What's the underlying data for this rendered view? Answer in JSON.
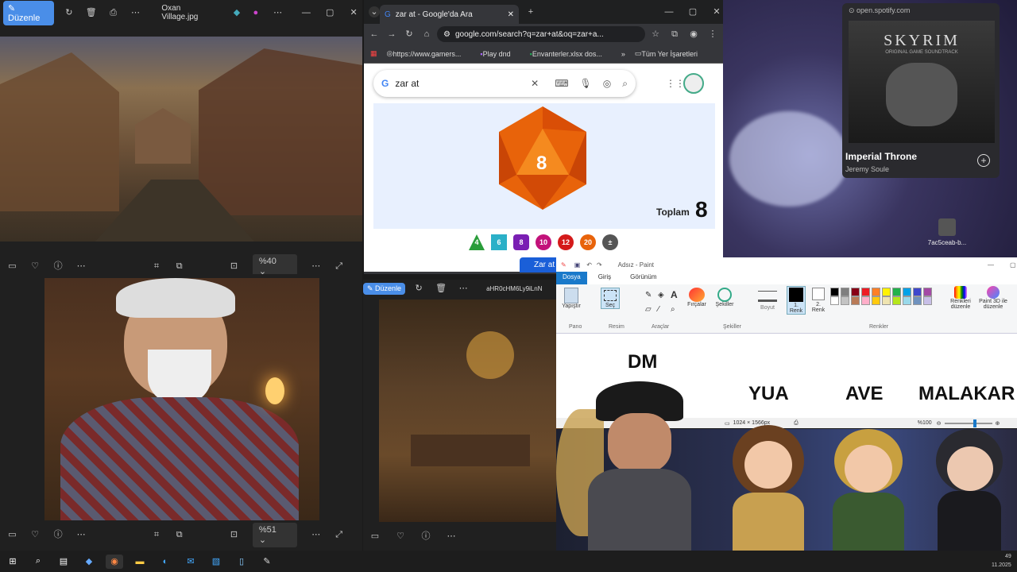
{
  "photos_top": {
    "edit_label": "Düzenle",
    "file_name": "Oxan Village.jpg",
    "zoom": "%40"
  },
  "photos_bottom": {
    "zoom": "%51"
  },
  "photos_mid": {
    "edit_label": "Düzenle",
    "file_name": "aHR0cHM6Ly9iLnN"
  },
  "chrome": {
    "tab_title": "zar at - Google'da Ara",
    "url": "google.com/search?q=zar+at&oq=zar+a...",
    "bookmarks": [
      "https://www.gamers...",
      "Play dnd",
      "Envanterler.xlsx dos...",
      "Tüm Yer İşaretleri"
    ],
    "search_query": "zar at",
    "dice_value": "8",
    "total_label": "Toplam",
    "total_value": "8",
    "dice_chips": [
      "4",
      "6",
      "8",
      "10",
      "12",
      "20",
      "±"
    ],
    "roll_button": "Zar at"
  },
  "spotify": {
    "url": "open.spotify.com",
    "album_title": "SKYRIM",
    "album_subtitle": "ORIGINAL GAME SOUNDTRACK",
    "track": "Imperial Throne",
    "artist": "Jeremy Soule"
  },
  "desktop": {
    "file_label": "7ac5ceab-b..."
  },
  "paint": {
    "title": "Adsız - Paint",
    "tabs": [
      "Dosya",
      "Giriş",
      "Görünüm"
    ],
    "groups": [
      "Pano",
      "Resim",
      "Araçlar",
      "Fırçalar",
      "Şekiller",
      "Boyut",
      "Renkler"
    ],
    "paste": "Yapıştır",
    "select": "Seç",
    "color1": "1. Renk",
    "color2": "2. Renk",
    "edit_colors": "Renkleri düzenle",
    "paint3d": "Paint 3D ile düzenle",
    "size_readout": "1024 × 1566px",
    "zoom": "%100"
  },
  "party": {
    "dm": "DM",
    "p1": "YUA",
    "p2": "AVE",
    "p3": "MALAKAR"
  },
  "tray": {
    "time": "49",
    "date": "11.2025"
  }
}
